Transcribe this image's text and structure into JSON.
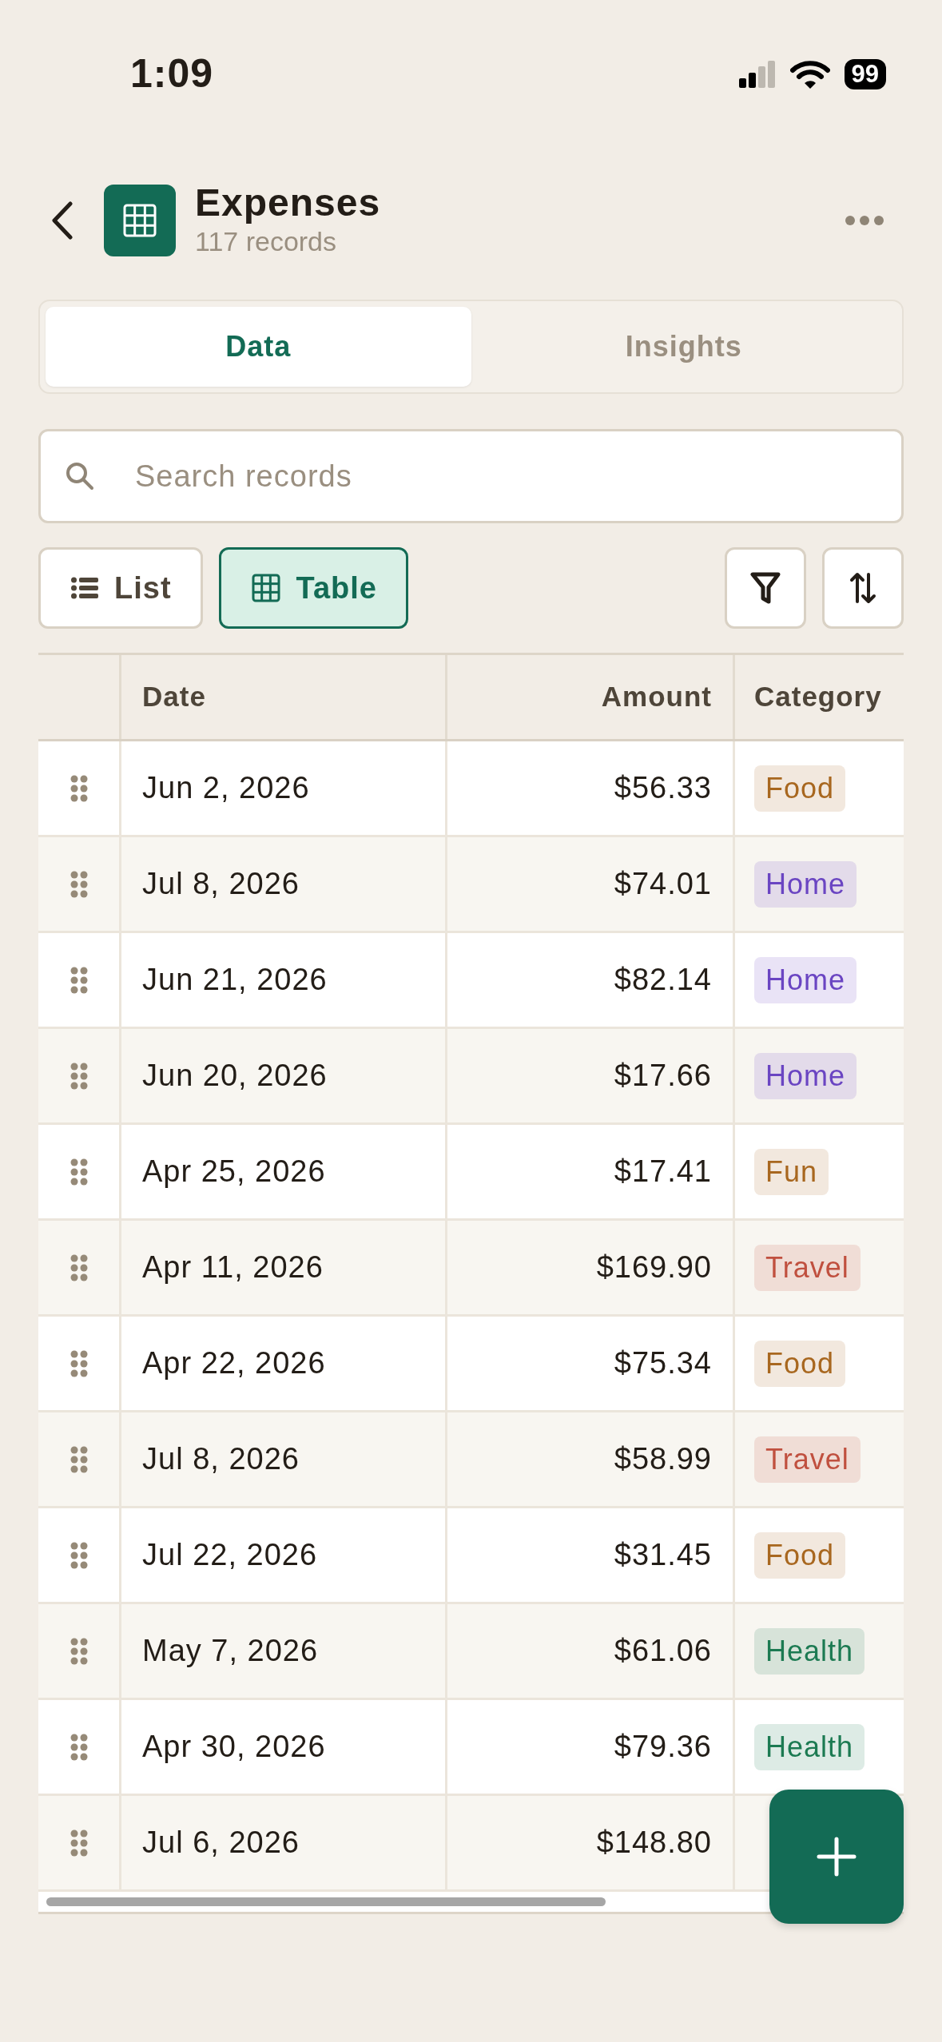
{
  "status_bar": {
    "time": "1:09",
    "battery": "99"
  },
  "header": {
    "title": "Expenses",
    "subtitle": "117 records"
  },
  "tabs": [
    {
      "label": "Data",
      "selected": true
    },
    {
      "label": "Insights",
      "selected": false
    }
  ],
  "search": {
    "placeholder": "Search records"
  },
  "view_toggle": [
    {
      "label": "List",
      "kind": "list",
      "selected": false
    },
    {
      "label": "Table",
      "kind": "table",
      "selected": true
    }
  ],
  "table": {
    "columns": [
      "Date",
      "Amount",
      "Category"
    ],
    "rows": [
      {
        "date": "Jun 2, 2026",
        "amount": "$56.33",
        "category": {
          "label": "Food",
          "color": "#a8671f"
        }
      },
      {
        "date": "Jul 8, 2026",
        "amount": "$74.01",
        "category": {
          "label": "Home",
          "color": "#6a45c2"
        }
      },
      {
        "date": "Jun 21, 2026",
        "amount": "$82.14",
        "category": {
          "label": "Home",
          "color": "#6a45c2"
        }
      },
      {
        "date": "Jun 20, 2026",
        "amount": "$17.66",
        "category": {
          "label": "Home",
          "color": "#6a45c2"
        }
      },
      {
        "date": "Apr 25, 2026",
        "amount": "$17.41",
        "category": {
          "label": "Fun",
          "color": "#a8671f"
        }
      },
      {
        "date": "Apr 11, 2026",
        "amount": "$169.90",
        "category": {
          "label": "Travel",
          "color": "#c0503f"
        }
      },
      {
        "date": "Apr 22, 2026",
        "amount": "$75.34",
        "category": {
          "label": "Food",
          "color": "#a8671f"
        }
      },
      {
        "date": "Jul 8, 2026",
        "amount": "$58.99",
        "category": {
          "label": "Travel",
          "color": "#c0503f"
        }
      },
      {
        "date": "Jul 22, 2026",
        "amount": "$31.45",
        "category": {
          "label": "Food",
          "color": "#a8671f"
        }
      },
      {
        "date": "May 7, 2026",
        "amount": "$61.06",
        "category": {
          "label": "Health",
          "color": "#1c7a52"
        }
      },
      {
        "date": "Apr 30, 2026",
        "amount": "$79.36",
        "category": {
          "label": "Health",
          "color": "#1c7a52"
        }
      },
      {
        "date": "Jul 6, 2026",
        "amount": "$148.80"
      }
    ]
  }
}
